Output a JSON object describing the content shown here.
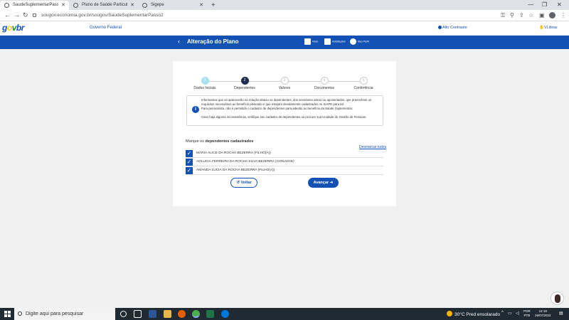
{
  "browser": {
    "tabs": [
      {
        "label": "SaudeSuplementarPasso2",
        "active": true
      },
      {
        "label": "Plano de Saúde Particular - Resu",
        "active": false
      },
      {
        "label": "Sigepe",
        "active": false
      }
    ],
    "new_tab": "+",
    "url": "sougov.economia.gov.br/sougov/SaudeSuplementarPasso2"
  },
  "gov_header": {
    "logo": {
      "g": "g",
      "o": "o",
      "v": "v",
      "b": "br"
    },
    "governo": "Governo Federal",
    "contrast": "Alto Contraste",
    "vlibras": "VLibras"
  },
  "bluebar": {
    "back": "‹",
    "title": "Alteração do Plano",
    "nav": [
      {
        "label": "Início",
        "icon": "home-icon"
      },
      {
        "label": "Solicitações",
        "icon": "document-icon"
      },
      {
        "label": "Meu Perfil",
        "icon": "user-icon"
      }
    ]
  },
  "steps": [
    {
      "num": "1",
      "label": "Dados Iniciais",
      "state": "done"
    },
    {
      "num": "2",
      "label": "Dependentes",
      "state": "active"
    },
    {
      "num": "3",
      "label": "Valores",
      "state": "todo"
    },
    {
      "num": "4",
      "label": "Documentos",
      "state": "todo"
    },
    {
      "num": "5",
      "label": "Conferência",
      "state": "todo"
    }
  ],
  "info": {
    "icon": "i",
    "line1": "Informamos que só aparecerão na relação abaixo os dependentes, dos servidores ativos ou aposentados, que preencham os requisitos necessários ao benefício pleiteado e que estejam devidamente cadastrados no SIAPE para tal.",
    "line2": "Para pensionista, não é permitido o cadastro de dependentes para adesão ao benefício da Saúde Suplementar.",
    "line3": "Caso haja alguma inconsistência, verifique seu cadastro de dependentes ou procure sua Unidade de Gestão de Pessoas."
  },
  "dependents": {
    "label_prefix": "Marque os",
    "label_bold": "dependentes cadastrados",
    "unmark_all": "Desmarcar todos",
    "items": [
      {
        "name": "MARIA ALICE DA ROCHA BEZERRA (FILHO(A))",
        "checked": true
      },
      {
        "name": "ADLUCIA FERREIRA DA ROCHA SILVA BEZERRA (CONJUGE)",
        "checked": true
      },
      {
        "name": "AMANDA LUCIA DA ROCHA BEZERRA (FILHO(A))",
        "checked": true
      }
    ]
  },
  "buttons": {
    "voltar": "Voltar",
    "avancar": "Avançar"
  },
  "taskbar": {
    "search_placeholder": "Digite aqui para pesquisar",
    "weather": "30°C  Pred ensolarado",
    "lang_top": "POR",
    "lang_bottom": "PTB",
    "time": "12:18",
    "date": "26/07/2022"
  }
}
